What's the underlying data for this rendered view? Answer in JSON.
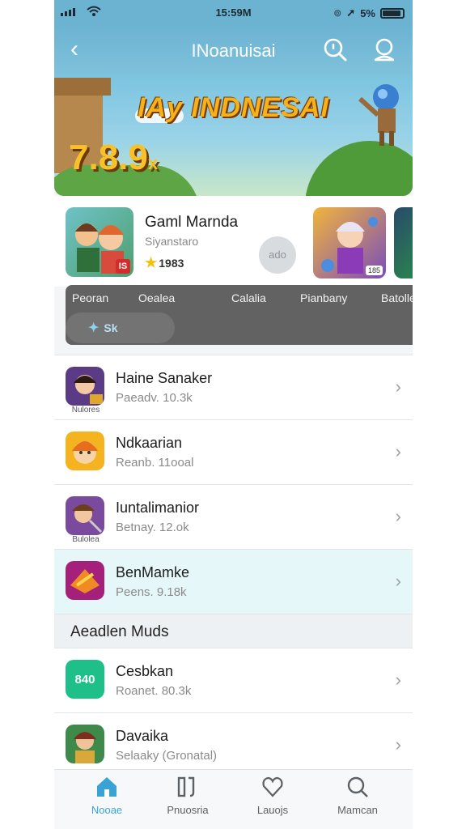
{
  "status_bar": {
    "time": "15:59M",
    "battery": "5%"
  },
  "header": {
    "title": "INoanuisai"
  },
  "banner": {
    "title": "IAy INDNESAI",
    "score": "7.8.9",
    "score_suffix": "x"
  },
  "featured": {
    "name": "Gaml Marnda",
    "subtitle": "Siyanstaro",
    "rating": "1983",
    "thumb_badge": "IS",
    "placeholder": "ado",
    "thumb2_badge": "185"
  },
  "tabs": {
    "items": [
      "Peoran",
      "Oealea",
      "Calalia",
      "Pianbany",
      "Batolle"
    ],
    "pill_label": "Sk"
  },
  "list": {
    "rows": [
      {
        "title": "Haine Sanaker",
        "subtitle": "Paeadv. 10.3k",
        "caption": "Nulores",
        "icon_color": "#5b3a86"
      },
      {
        "title": "Ndkaarian",
        "subtitle": "Reanb. 11ooal",
        "caption": "",
        "icon_color": "#f4b31f"
      },
      {
        "title": "Iuntalimanior",
        "subtitle": "Betnay. 12.ok",
        "caption": "Bulolea",
        "icon_color": "#7a4a9e"
      },
      {
        "title": "BenMamke",
        "subtitle": "Peens. 9.18k",
        "caption": "",
        "icon_color": "#a4207a"
      }
    ],
    "section_title": "Aeadlen Muds",
    "section_rows": [
      {
        "title": "Cesbkan",
        "subtitle": "Roanet. 80.3k",
        "icon_label": "840",
        "icon_color": "#1fbf8a"
      },
      {
        "title": "Davaika",
        "subtitle": "Selaaky (Gronatal)",
        "icon_color": "#3e8a4b"
      }
    ]
  },
  "bottom_nav": [
    {
      "label": "Nooae",
      "icon": "home-icon",
      "active": true
    },
    {
      "label": "Pnuosria",
      "icon": "library-icon",
      "active": false
    },
    {
      "label": "Lauojs",
      "icon": "favorites-icon",
      "active": false
    },
    {
      "label": "Mamcan",
      "icon": "search-icon",
      "active": false
    }
  ],
  "colors": {
    "accent": "#3aa3d6",
    "header": "#6cb3d2",
    "highlight_row": "#e6f7fa"
  }
}
